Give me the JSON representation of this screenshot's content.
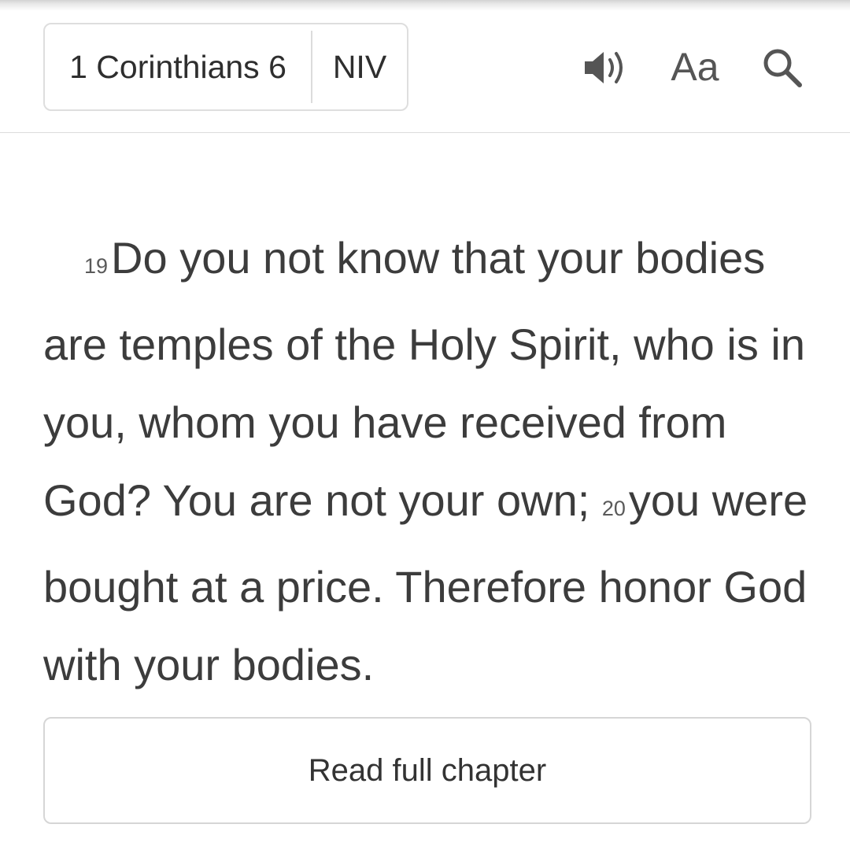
{
  "header": {
    "book_chapter": "1 Corinthians 6",
    "version": "NIV",
    "font_button_label": "Aa",
    "icons": {
      "audio": "speaker-volume-icon",
      "search": "magnifier-search-icon"
    }
  },
  "passage": {
    "verses": [
      {
        "number": "19",
        "text": "Do you not know that your bodies are temples of the Holy Spirit, who is in you, whom you have received from God? You are not your own; "
      },
      {
        "number": "20",
        "text": "you were bought at a price. Therefore honor God with your bodies."
      }
    ]
  },
  "footer": {
    "read_full_chapter_label": "Read full chapter"
  },
  "colors": {
    "text": "#3c3c3c",
    "border": "#dedede",
    "icon": "#555555"
  }
}
